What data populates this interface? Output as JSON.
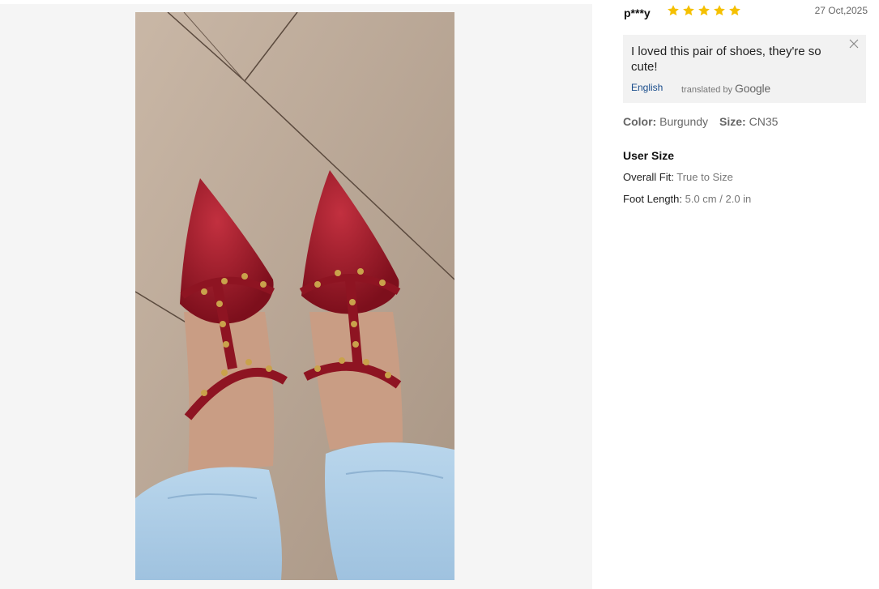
{
  "review": {
    "user": "p***y",
    "rating": 5,
    "date": "27 Oct,2025",
    "translation": {
      "text": "I loved this pair of shoes, they're so cute!",
      "language": "English",
      "translated_by": "translated by",
      "provider": "Google"
    },
    "sku": {
      "color_label": "Color:",
      "color_value": "Burgundy",
      "size_label": "Size:",
      "size_value": "CN35"
    },
    "user_size": {
      "title": "User Size",
      "fit_label": "Overall Fit:",
      "fit_value": "True to Size",
      "foot_label": "Foot Length:",
      "foot_value": "5.0 cm / 2.0 in"
    }
  },
  "colors": {
    "star": "#f5c000",
    "shoe": "#8e1422",
    "link": "#1a4d8c"
  },
  "icons": [
    "star-icon",
    "close-icon"
  ]
}
